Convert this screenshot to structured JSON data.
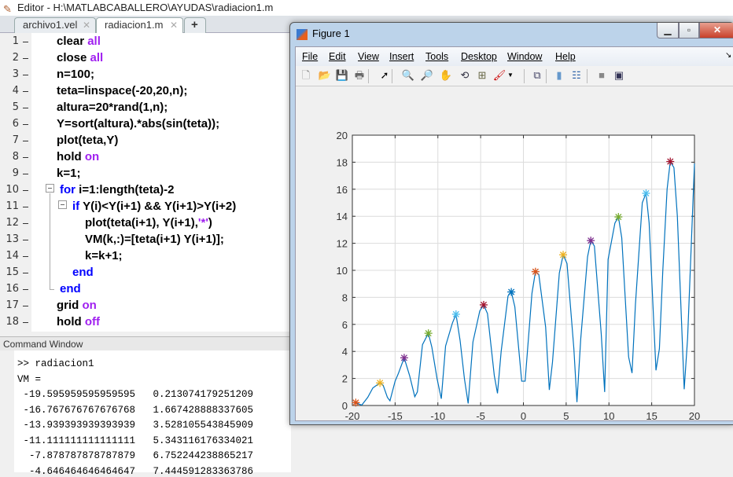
{
  "editor": {
    "title": "Editor - H:\\MATLABCABALLERO\\AYUDAS\\radiacion1.m",
    "tabs": [
      {
        "label": "archivo1.vel",
        "active": false
      },
      {
        "label": "radiacion1.m",
        "active": true
      }
    ],
    "add_tab": "+",
    "lines": [
      {
        "n": "1",
        "parts": [
          [
            "clear ",
            ""
          ],
          [
            "all",
            "pu"
          ]
        ]
      },
      {
        "n": "2",
        "parts": [
          [
            "close ",
            ""
          ],
          [
            "all",
            "pu"
          ]
        ]
      },
      {
        "n": "3",
        "parts": [
          [
            "n=100;",
            ""
          ]
        ]
      },
      {
        "n": "4",
        "parts": [
          [
            "teta=linspace(-20,20,n);",
            ""
          ]
        ]
      },
      {
        "n": "5",
        "parts": [
          [
            "altura=20*rand(1,n);",
            ""
          ]
        ]
      },
      {
        "n": "6",
        "parts": [
          [
            "Y=sort(altura).*abs(sin(teta));",
            ""
          ]
        ]
      },
      {
        "n": "7",
        "parts": [
          [
            "plot(teta,Y)",
            ""
          ]
        ]
      },
      {
        "n": "8",
        "parts": [
          [
            "hold ",
            ""
          ],
          [
            "on",
            "pu"
          ]
        ]
      },
      {
        "n": "9",
        "parts": [
          [
            "k=1;",
            ""
          ]
        ]
      },
      {
        "n": "10",
        "parts": [
          [
            "for ",
            "kw"
          ],
          [
            "i=1:length(teta)-2",
            ""
          ]
        ]
      },
      {
        "n": "11",
        "parts": [
          [
            "if ",
            "kw"
          ],
          [
            "Y(i)<Y(i+1) && Y(i+1)>Y(i+2)",
            ""
          ]
        ]
      },
      {
        "n": "12",
        "parts": [
          [
            "plot(teta(i+1), Y(i+1),",
            ""
          ],
          [
            "'*'",
            "pu"
          ],
          [
            ")",
            ""
          ]
        ]
      },
      {
        "n": "13",
        "parts": [
          [
            "VM(k,:)=[teta(i+1) Y(i+1)];",
            ""
          ]
        ]
      },
      {
        "n": "14",
        "parts": [
          [
            "k=k+1;",
            ""
          ]
        ]
      },
      {
        "n": "15",
        "parts": [
          [
            "end",
            "kw"
          ]
        ]
      },
      {
        "n": "16",
        "parts": [
          [
            "end",
            "kw"
          ]
        ]
      },
      {
        "n": "17",
        "parts": [
          [
            "grid ",
            ""
          ],
          [
            "on",
            "pu"
          ]
        ]
      },
      {
        "n": "18",
        "parts": [
          [
            "hold ",
            ""
          ],
          [
            "off",
            "pu"
          ]
        ]
      }
    ]
  },
  "command_window": {
    "title": "Command Window",
    "lines": [
      ">> radiacion1",
      "VM =",
      " -19.595959595959595   0.213074179251209",
      " -16.767676767676768   1.667428888337605",
      " -13.939393939393939   3.528105543845909",
      " -11.111111111111111   5.343116176334021",
      "  -7.878787878787879   6.752244238865217",
      "  -4.646464646464647   7.444591283363786"
    ]
  },
  "figure": {
    "title": "Figure 1",
    "menus": [
      "File",
      "Edit",
      "View",
      "Insert",
      "Tools",
      "Desktop",
      "Window",
      "Help"
    ],
    "toolbar": [
      "new-file-icon",
      "open-folder-icon",
      "save-icon",
      "print-icon",
      "pointer-icon",
      "zoom-in-icon",
      "zoom-out-icon",
      "pan-hand-icon",
      "rotate-3d-icon",
      "data-cursor-icon",
      "brush-icon",
      "link-icon",
      "colorbar-icon",
      "legend-icon",
      "hide-plot-tools-icon",
      "show-plot-tools-icon"
    ]
  },
  "chart_data": {
    "type": "line",
    "xlim": [
      -20,
      20
    ],
    "ylim": [
      0,
      20
    ],
    "grid": true,
    "xticks": [
      "-20",
      "-15",
      "-10",
      "-5",
      "0",
      "5",
      "10",
      "15",
      "20"
    ],
    "yticks": [
      "0",
      "2",
      "4",
      "6",
      "8",
      "10",
      "12",
      "14",
      "16",
      "18",
      "20"
    ],
    "line": {
      "color": "#0072BD",
      "x": [
        -20,
        -19.6,
        -19.2,
        -18.9,
        -18.2,
        -17.6,
        -16.77,
        -16.4,
        -15.9,
        -15.6,
        -15.0,
        -14.6,
        -13.94,
        -13.3,
        -12.7,
        -12.4,
        -11.8,
        -11.11,
        -10.7,
        -10.1,
        -9.6,
        -9.1,
        -8.3,
        -7.88,
        -7.4,
        -6.9,
        -6.46,
        -5.9,
        -5.1,
        -4.65,
        -4.2,
        -3.4,
        -3.03,
        -2.6,
        -1.8,
        -1.41,
        -1.0,
        -0.2,
        0.2,
        1.0,
        1.41,
        1.8,
        2.6,
        3.03,
        3.4,
        4.2,
        4.65,
        5.1,
        5.9,
        6.26,
        6.7,
        7.5,
        7.88,
        8.3,
        9.1,
        9.5,
        9.9,
        10.7,
        11.11,
        11.5,
        12.3,
        12.7,
        13.1,
        13.9,
        14.34,
        14.7,
        15.5,
        15.9,
        16.3,
        16.8,
        17.17,
        17.6,
        18.0,
        18.8,
        19.2,
        20
      ],
      "y": [
        0.2,
        0.21,
        0.1,
        0.03,
        0.6,
        1.3,
        1.67,
        1.5,
        0.6,
        0.35,
        1.8,
        2.4,
        3.53,
        2.2,
        0.65,
        1.0,
        4.5,
        5.34,
        4.3,
        2.0,
        0.5,
        4.4,
        6.1,
        6.75,
        4.8,
        2.0,
        0.15,
        4.7,
        7.0,
        7.44,
        6.8,
        2.2,
        0.9,
        4.0,
        8.1,
        8.4,
        7.3,
        1.8,
        1.8,
        8.3,
        9.9,
        9.7,
        5.8,
        1.15,
        3.2,
        9.8,
        11.15,
        10.5,
        4.2,
        0.25,
        4.9,
        11.0,
        12.2,
        11.8,
        5.3,
        1.0,
        10.8,
        13.5,
        13.95,
        12.4,
        3.6,
        2.4,
        7.5,
        15.0,
        15.7,
        13.5,
        2.6,
        4.2,
        10.0,
        16.0,
        18.05,
        17.6,
        14.0,
        1.2,
        5.0,
        17.9
      ]
    },
    "markers": {
      "symbol": "*",
      "x": [
        -19.596,
        -16.768,
        -13.939,
        -11.111,
        -7.879,
        -4.646,
        -1.414,
        1.414,
        4.646,
        7.879,
        11.111,
        14.343,
        17.172
      ],
      "y": [
        0.213,
        1.667,
        3.528,
        5.343,
        6.752,
        7.445,
        8.4,
        9.9,
        11.15,
        12.2,
        13.95,
        15.7,
        18.05
      ],
      "colors": [
        "#D95319",
        "#EDB120",
        "#7E2F8E",
        "#77AC30",
        "#4DBEEE",
        "#A2142F",
        "#0072BD",
        "#D95319",
        "#EDB120",
        "#7E2F8E",
        "#77AC30",
        "#4DBEEE",
        "#A2142F"
      ]
    }
  }
}
